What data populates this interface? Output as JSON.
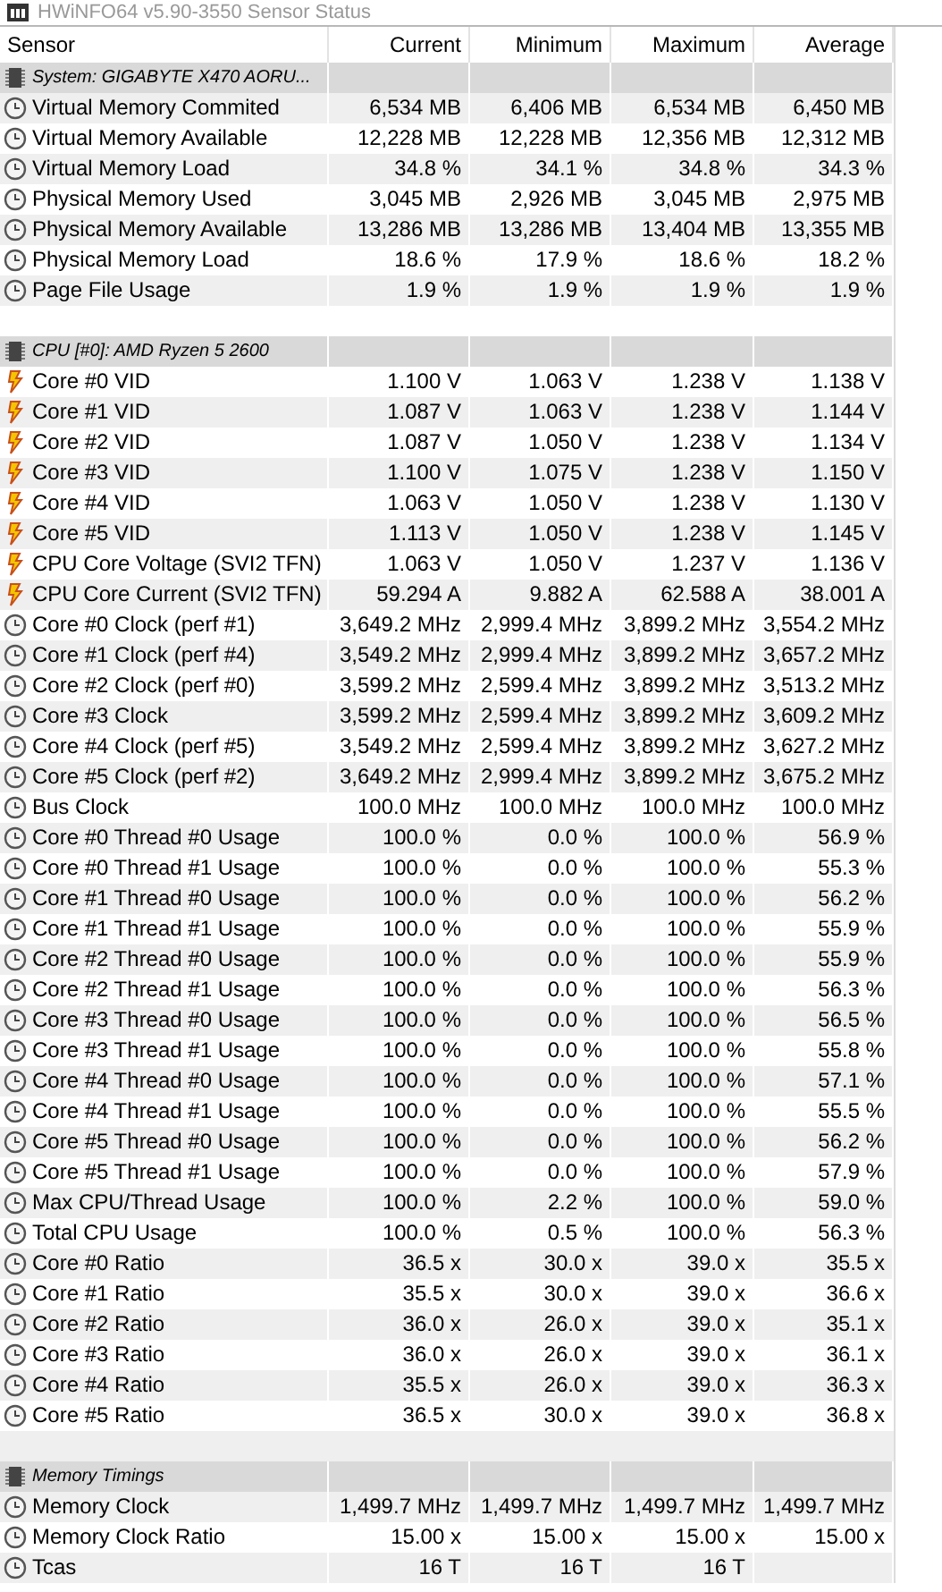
{
  "window": {
    "title": "HWiNFO64 v5.90-3550 Sensor Status"
  },
  "columns": [
    "Sensor",
    "Current",
    "Minimum",
    "Maximum",
    "Average"
  ],
  "sections": [
    {
      "title": "System: GIGABYTE X470 AORU...",
      "rows": [
        {
          "kind": "gauge",
          "label": "Virtual Memory Commited",
          "current": "6,534 MB",
          "minimum": "6,406 MB",
          "maximum": "6,534 MB",
          "average": "6,450 MB"
        },
        {
          "kind": "gauge",
          "label": "Virtual Memory Available",
          "current": "12,228 MB",
          "minimum": "12,228 MB",
          "maximum": "12,356 MB",
          "average": "12,312 MB"
        },
        {
          "kind": "gauge",
          "label": "Virtual Memory Load",
          "current": "34.8 %",
          "minimum": "34.1 %",
          "maximum": "34.8 %",
          "average": "34.3 %"
        },
        {
          "kind": "gauge",
          "label": "Physical Memory Used",
          "current": "3,045 MB",
          "minimum": "2,926 MB",
          "maximum": "3,045 MB",
          "average": "2,975 MB"
        },
        {
          "kind": "gauge",
          "label": "Physical Memory Available",
          "current": "13,286 MB",
          "minimum": "13,286 MB",
          "maximum": "13,404 MB",
          "average": "13,355 MB"
        },
        {
          "kind": "gauge",
          "label": "Physical Memory Load",
          "current": "18.6 %",
          "minimum": "17.9 %",
          "maximum": "18.6 %",
          "average": "18.2 %"
        },
        {
          "kind": "gauge",
          "label": "Page File Usage",
          "current": "1.9 %",
          "minimum": "1.9 %",
          "maximum": "1.9 %",
          "average": "1.9 %"
        }
      ]
    },
    {
      "title": "CPU [#0]: AMD Ryzen 5 2600",
      "rows": [
        {
          "kind": "bolt",
          "label": "Core #0 VID",
          "current": "1.100 V",
          "minimum": "1.063 V",
          "maximum": "1.238 V",
          "average": "1.138 V"
        },
        {
          "kind": "bolt",
          "label": "Core #1 VID",
          "current": "1.087 V",
          "minimum": "1.063 V",
          "maximum": "1.238 V",
          "average": "1.144 V"
        },
        {
          "kind": "bolt",
          "label": "Core #2 VID",
          "current": "1.087 V",
          "minimum": "1.050 V",
          "maximum": "1.238 V",
          "average": "1.134 V"
        },
        {
          "kind": "bolt",
          "label": "Core #3 VID",
          "current": "1.100 V",
          "minimum": "1.075 V",
          "maximum": "1.238 V",
          "average": "1.150 V"
        },
        {
          "kind": "bolt",
          "label": "Core #4 VID",
          "current": "1.063 V",
          "minimum": "1.050 V",
          "maximum": "1.238 V",
          "average": "1.130 V"
        },
        {
          "kind": "bolt",
          "label": "Core #5 VID",
          "current": "1.113 V",
          "minimum": "1.050 V",
          "maximum": "1.238 V",
          "average": "1.145 V"
        },
        {
          "kind": "bolt",
          "label": "CPU Core Voltage (SVI2 TFN)",
          "current": "1.063 V",
          "minimum": "1.050 V",
          "maximum": "1.237 V",
          "average": "1.136 V"
        },
        {
          "kind": "bolt",
          "label": "CPU Core Current (SVI2 TFN)",
          "current": "59.294 A",
          "minimum": "9.882 A",
          "maximum": "62.588 A",
          "average": "38.001 A"
        },
        {
          "kind": "gauge",
          "label": "Core #0 Clock (perf #1)",
          "current": "3,649.2 MHz",
          "minimum": "2,999.4 MHz",
          "maximum": "3,899.2 MHz",
          "average": "3,554.2 MHz"
        },
        {
          "kind": "gauge",
          "label": "Core #1 Clock (perf #4)",
          "current": "3,549.2 MHz",
          "minimum": "2,999.4 MHz",
          "maximum": "3,899.2 MHz",
          "average": "3,657.2 MHz"
        },
        {
          "kind": "gauge",
          "label": "Core #2 Clock (perf #0)",
          "current": "3,599.2 MHz",
          "minimum": "2,599.4 MHz",
          "maximum": "3,899.2 MHz",
          "average": "3,513.2 MHz"
        },
        {
          "kind": "gauge",
          "label": "Core #3 Clock",
          "current": "3,599.2 MHz",
          "minimum": "2,599.4 MHz",
          "maximum": "3,899.2 MHz",
          "average": "3,609.2 MHz"
        },
        {
          "kind": "gauge",
          "label": "Core #4 Clock (perf #5)",
          "current": "3,549.2 MHz",
          "minimum": "2,599.4 MHz",
          "maximum": "3,899.2 MHz",
          "average": "3,627.2 MHz"
        },
        {
          "kind": "gauge",
          "label": "Core #5 Clock (perf #2)",
          "current": "3,649.2 MHz",
          "minimum": "2,999.4 MHz",
          "maximum": "3,899.2 MHz",
          "average": "3,675.2 MHz"
        },
        {
          "kind": "gauge",
          "label": "Bus Clock",
          "current": "100.0 MHz",
          "minimum": "100.0 MHz",
          "maximum": "100.0 MHz",
          "average": "100.0 MHz"
        },
        {
          "kind": "gauge",
          "label": "Core #0 Thread #0 Usage",
          "current": "100.0 %",
          "minimum": "0.0 %",
          "maximum": "100.0 %",
          "average": "56.9 %"
        },
        {
          "kind": "gauge",
          "label": "Core #0 Thread #1 Usage",
          "current": "100.0 %",
          "minimum": "0.0 %",
          "maximum": "100.0 %",
          "average": "55.3 %"
        },
        {
          "kind": "gauge",
          "label": "Core #1 Thread #0 Usage",
          "current": "100.0 %",
          "minimum": "0.0 %",
          "maximum": "100.0 %",
          "average": "56.2 %"
        },
        {
          "kind": "gauge",
          "label": "Core #1 Thread #1 Usage",
          "current": "100.0 %",
          "minimum": "0.0 %",
          "maximum": "100.0 %",
          "average": "55.9 %"
        },
        {
          "kind": "gauge",
          "label": "Core #2 Thread #0 Usage",
          "current": "100.0 %",
          "minimum": "0.0 %",
          "maximum": "100.0 %",
          "average": "55.9 %"
        },
        {
          "kind": "gauge",
          "label": "Core #2 Thread #1 Usage",
          "current": "100.0 %",
          "minimum": "0.0 %",
          "maximum": "100.0 %",
          "average": "56.3 %"
        },
        {
          "kind": "gauge",
          "label": "Core #3 Thread #0 Usage",
          "current": "100.0 %",
          "minimum": "0.0 %",
          "maximum": "100.0 %",
          "average": "56.5 %"
        },
        {
          "kind": "gauge",
          "label": "Core #3 Thread #1 Usage",
          "current": "100.0 %",
          "minimum": "0.0 %",
          "maximum": "100.0 %",
          "average": "55.8 %"
        },
        {
          "kind": "gauge",
          "label": "Core #4 Thread #0 Usage",
          "current": "100.0 %",
          "minimum": "0.0 %",
          "maximum": "100.0 %",
          "average": "57.1 %"
        },
        {
          "kind": "gauge",
          "label": "Core #4 Thread #1 Usage",
          "current": "100.0 %",
          "minimum": "0.0 %",
          "maximum": "100.0 %",
          "average": "55.5 %"
        },
        {
          "kind": "gauge",
          "label": "Core #5 Thread #0 Usage",
          "current": "100.0 %",
          "minimum": "0.0 %",
          "maximum": "100.0 %",
          "average": "56.2 %"
        },
        {
          "kind": "gauge",
          "label": "Core #5 Thread #1 Usage",
          "current": "100.0 %",
          "minimum": "0.0 %",
          "maximum": "100.0 %",
          "average": "57.9 %"
        },
        {
          "kind": "gauge",
          "label": "Max CPU/Thread Usage",
          "current": "100.0 %",
          "minimum": "2.2 %",
          "maximum": "100.0 %",
          "average": "59.0 %"
        },
        {
          "kind": "gauge",
          "label": "Total CPU Usage",
          "current": "100.0 %",
          "minimum": "0.5 %",
          "maximum": "100.0 %",
          "average": "56.3 %"
        },
        {
          "kind": "gauge",
          "label": "Core #0 Ratio",
          "current": "36.5 x",
          "minimum": "30.0 x",
          "maximum": "39.0 x",
          "average": "35.5 x"
        },
        {
          "kind": "gauge",
          "label": "Core #1 Ratio",
          "current": "35.5 x",
          "minimum": "30.0 x",
          "maximum": "39.0 x",
          "average": "36.6 x"
        },
        {
          "kind": "gauge",
          "label": "Core #2 Ratio",
          "current": "36.0 x",
          "minimum": "26.0 x",
          "maximum": "39.0 x",
          "average": "35.1 x"
        },
        {
          "kind": "gauge",
          "label": "Core #3 Ratio",
          "current": "36.0 x",
          "minimum": "26.0 x",
          "maximum": "39.0 x",
          "average": "36.1 x"
        },
        {
          "kind": "gauge",
          "label": "Core #4 Ratio",
          "current": "35.5 x",
          "minimum": "26.0 x",
          "maximum": "39.0 x",
          "average": "36.3 x"
        },
        {
          "kind": "gauge",
          "label": "Core #5 Ratio",
          "current": "36.5 x",
          "minimum": "30.0 x",
          "maximum": "39.0 x",
          "average": "36.8 x"
        }
      ]
    },
    {
      "title": "Memory Timings",
      "rows": [
        {
          "kind": "gauge",
          "label": "Memory Clock",
          "current": "1,499.7 MHz",
          "minimum": "1,499.7 MHz",
          "maximum": "1,499.7 MHz",
          "average": "1,499.7 MHz"
        },
        {
          "kind": "gauge",
          "label": "Memory Clock Ratio",
          "current": "15.00 x",
          "minimum": "15.00 x",
          "maximum": "15.00 x",
          "average": "15.00 x"
        },
        {
          "kind": "gauge",
          "label": "Tcas",
          "current": "16 T",
          "minimum": "16 T",
          "maximum": "16 T"
        }
      ]
    }
  ]
}
